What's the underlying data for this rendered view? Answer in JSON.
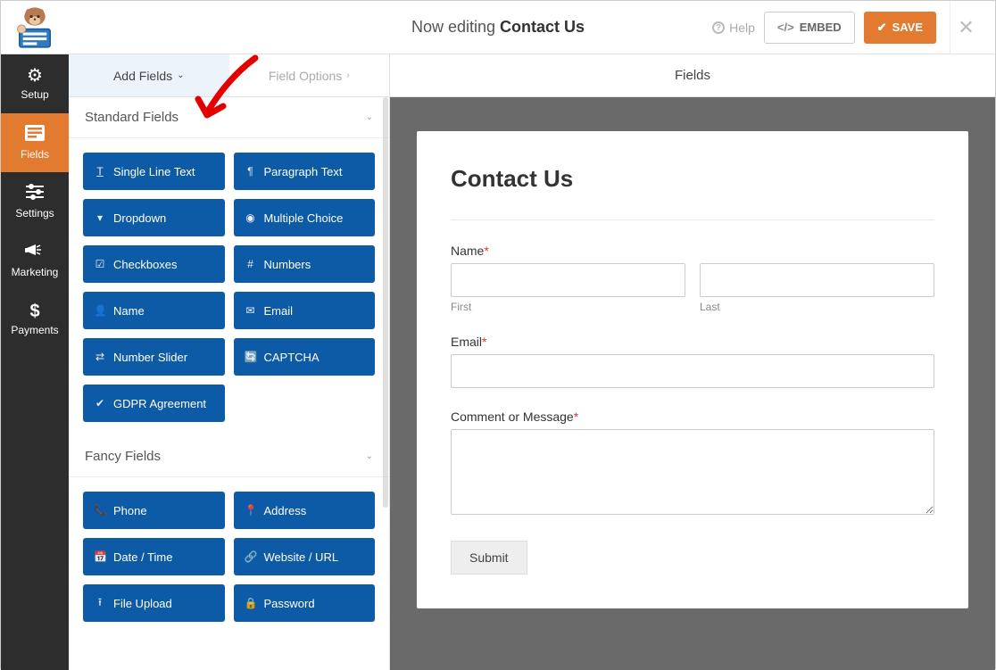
{
  "header": {
    "editing_prefix": "Now editing ",
    "form_name": "Contact Us",
    "help": "Help",
    "embed": "EMBED",
    "save": "SAVE"
  },
  "sidebar": {
    "items": [
      {
        "label": "Setup"
      },
      {
        "label": "Fields"
      },
      {
        "label": "Settings"
      },
      {
        "label": "Marketing"
      },
      {
        "label": "Payments"
      }
    ]
  },
  "panel": {
    "tab_add": "Add Fields",
    "tab_options": "Field Options",
    "preview_header": "Fields",
    "sections": {
      "standard": {
        "title": "Standard Fields",
        "fields": [
          "Single Line Text",
          "Paragraph Text",
          "Dropdown",
          "Multiple Choice",
          "Checkboxes",
          "Numbers",
          "Name",
          "Email",
          "Number Slider",
          "CAPTCHA",
          "GDPR Agreement"
        ]
      },
      "fancy": {
        "title": "Fancy Fields",
        "fields": [
          "Phone",
          "Address",
          "Date / Time",
          "Website / URL",
          "File Upload",
          "Password"
        ]
      }
    }
  },
  "form": {
    "title": "Contact Us",
    "name_label": "Name",
    "first_sub": "First",
    "last_sub": "Last",
    "email_label": "Email",
    "message_label": "Comment or Message",
    "submit": "Submit",
    "required_mark": "*"
  }
}
